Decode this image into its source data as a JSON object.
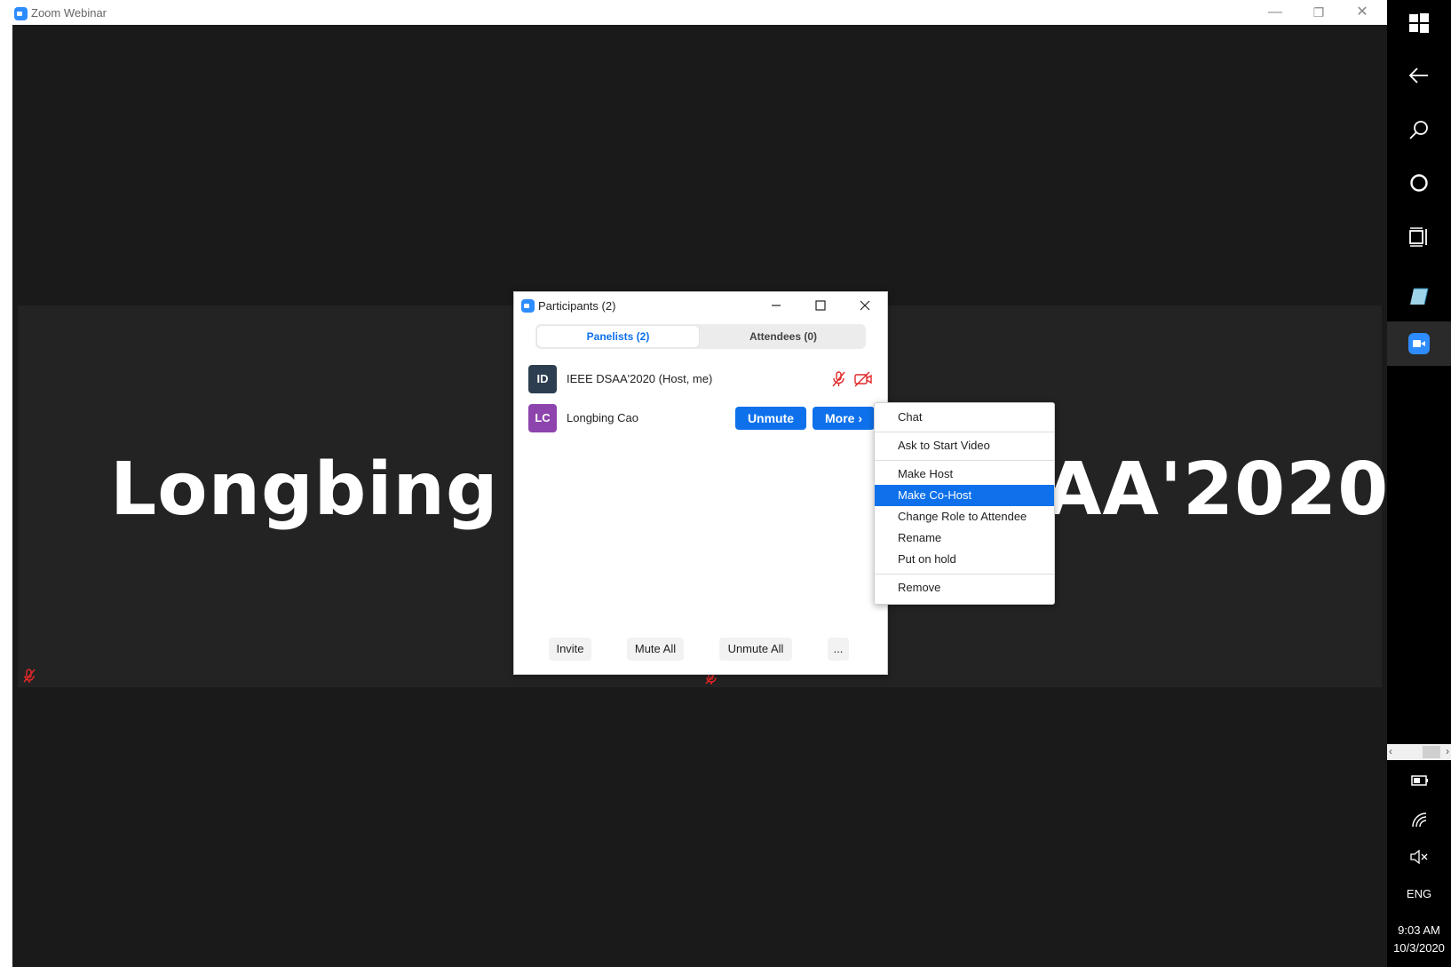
{
  "window": {
    "title": "Zoom Webinar",
    "controls": {
      "minimize": "—",
      "restore": "❐",
      "close": "✕"
    }
  },
  "stage": {
    "left_name": "Longbing C",
    "right_name": "AA'2020"
  },
  "taskbar": {
    "language": "ENG",
    "time": "9:03 AM",
    "date": "10/3/2020"
  },
  "participants": {
    "title": "Participants (2)",
    "tabs": {
      "panelists": "Panelists (2)",
      "attendees": "Attendees (0)"
    },
    "rows": [
      {
        "initials": "ID",
        "name": "IEEE DSAA'2020 (Host, me)",
        "color": "#2d3e50"
      },
      {
        "initials": "LC",
        "name": "Longbing Cao",
        "color": "#8e44ad"
      }
    ],
    "unmute": "Unmute",
    "more": "More ›",
    "footer": {
      "invite": "Invite",
      "mute_all": "Mute All",
      "unmute_all": "Unmute All",
      "more": "..."
    }
  },
  "menu": {
    "chat": "Chat",
    "ask_video": "Ask to Start Video",
    "make_host": "Make Host",
    "make_cohost": "Make Co-Host",
    "change_role": "Change Role to Attendee",
    "rename": "Rename",
    "put_on_hold": "Put on hold",
    "remove": "Remove"
  },
  "colors": {
    "accent": "#0e71eb",
    "zoom_blue": "#2d8cff",
    "muted_red": "#e02828"
  }
}
